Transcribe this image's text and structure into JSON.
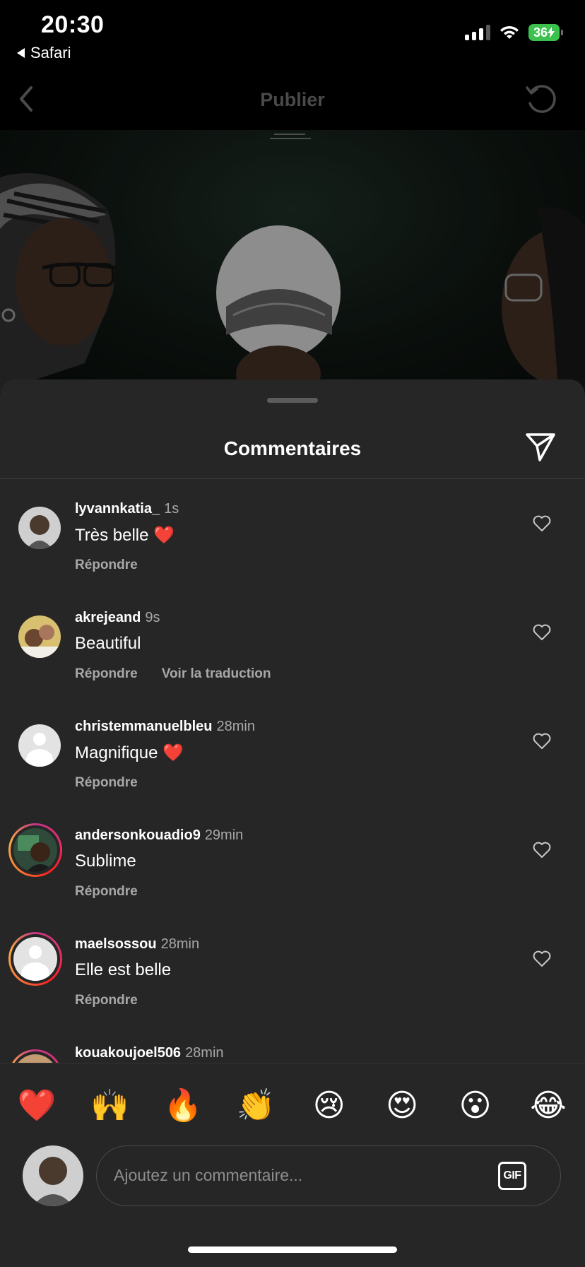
{
  "status_bar": {
    "time": "20:30",
    "back_app": "Safari",
    "battery": "36"
  },
  "nav": {
    "title": "Publier"
  },
  "sheet": {
    "title": "Commentaires"
  },
  "comments": [
    {
      "user": "lyvannkatia_",
      "ago": "1s",
      "text": "Très belle ❤️",
      "reply": "Répondre",
      "translate": ""
    },
    {
      "user": "akrejeand",
      "ago": "9s",
      "text": "Beautiful",
      "reply": "Répondre",
      "translate": "Voir la traduction"
    },
    {
      "user": "christemmanuelbleu",
      "ago": "28min",
      "text": "Magnifique ❤️",
      "reply": "Répondre",
      "translate": ""
    },
    {
      "user": "andersonkouadio9",
      "ago": "29min",
      "text": "Sublime",
      "reply": "Répondre",
      "translate": ""
    },
    {
      "user": "maelsossou",
      "ago": "28min",
      "text": "Elle est belle",
      "reply": "Répondre",
      "translate": ""
    },
    {
      "user": "kouakoujoel506",
      "ago": "28min",
      "text": "",
      "reply": "",
      "translate": ""
    }
  ],
  "reactions": [
    "❤️",
    "🙌",
    "🔥",
    "👏",
    "😢",
    "😍",
    "😮",
    "😂"
  ],
  "composer": {
    "placeholder": "Ajoutez un commentaire...",
    "gif_label": "GIF"
  }
}
